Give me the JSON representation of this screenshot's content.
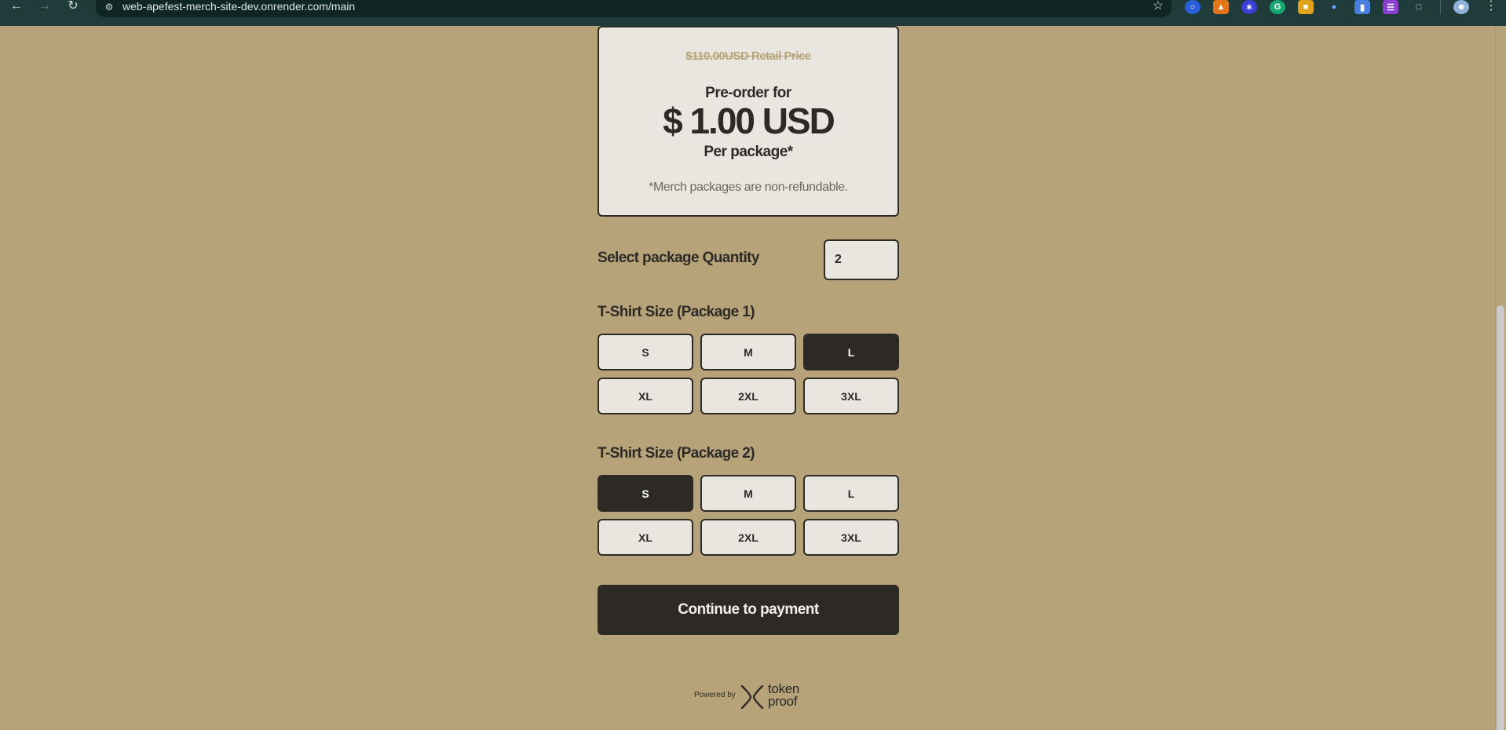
{
  "browser": {
    "url": "web-apefest-merch-site-dev.onrender.com/main"
  },
  "pricing": {
    "retail_price": "$110.00USD Retail Price",
    "preorder_label": "Pre-order for",
    "price": "$ 1.00 USD",
    "per_package": "Per package*",
    "disclaimer": "*Merch packages are non-refundable."
  },
  "quantity": {
    "label": "Select package Quantity",
    "value": "2"
  },
  "package1": {
    "title": "T-Shirt Size (Package 1)",
    "sizes": [
      "S",
      "M",
      "L",
      "XL",
      "2XL",
      "3XL"
    ],
    "selected": "L"
  },
  "package2": {
    "title": "T-Shirt Size (Package 2)",
    "sizes": [
      "S",
      "M",
      "L",
      "XL",
      "2XL",
      "3XL"
    ],
    "selected": "S"
  },
  "cta": {
    "label": "Continue to payment"
  },
  "footer": {
    "powered_by": "Powered by",
    "brand_line1": "token",
    "brand_line2": "proof"
  },
  "colors": {
    "page_background": "#b6a37a",
    "card_background": "#e9e6df",
    "dark": "#2d2a26"
  }
}
